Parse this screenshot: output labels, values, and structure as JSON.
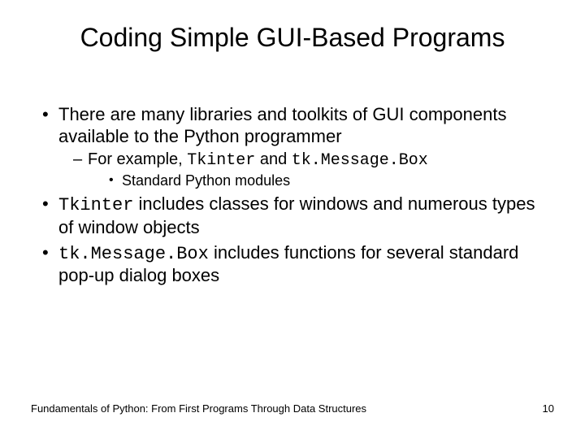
{
  "title": "Coding Simple GUI-Based Programs",
  "bullets": {
    "b1": "There are many libraries and toolkits of GUI components available to the Python programmer",
    "b1_sub_prefix": "For example, ",
    "b1_sub_code1": "Tkinter",
    "b1_sub_mid": " and ",
    "b1_sub_code2": "tk.Message.Box",
    "b1_subsub": "Standard Python modules",
    "b2_code": "Tkinter",
    "b2_rest": " includes classes for windows and numerous types of window objects",
    "b3_code": "tk.Message.Box",
    "b3_rest": " includes functions for several standard pop-up dialog boxes"
  },
  "footer": {
    "left": "Fundamentals of Python: From First Programs Through Data Structures",
    "page": "10"
  }
}
